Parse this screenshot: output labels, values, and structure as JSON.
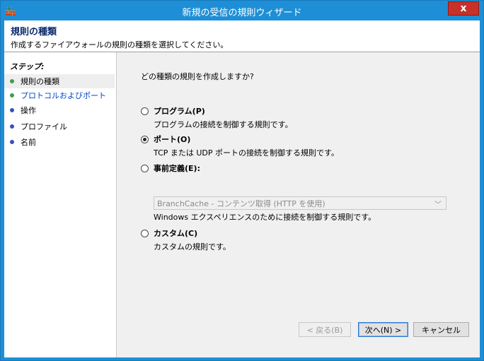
{
  "window": {
    "title": "新規の受信の規則ウィザード",
    "close_glyph": "x"
  },
  "header": {
    "title": "規則の種類",
    "description": "作成するファイアウォールの規則の種類を選択してください。"
  },
  "steps": {
    "title": "ステップ:",
    "items": [
      {
        "label": "規則の種類",
        "dot_color": "#3aa04a"
      },
      {
        "label": "プロトコルおよびポート",
        "dot_color": "#3aa04a"
      },
      {
        "label": "操作",
        "dot_color": "#3b4fb8"
      },
      {
        "label": "プロファイル",
        "dot_color": "#3b4fb8"
      },
      {
        "label": "名前",
        "dot_color": "#3b4fb8"
      }
    ]
  },
  "main": {
    "question": "どの種類の規則を作成しますか?",
    "options": [
      {
        "label": "プログラム(P)",
        "description": "プログラムの接続を制御する規則です。",
        "checked": false
      },
      {
        "label": "ポート(O)",
        "description": "TCP または UDP ポートの接続を制御する規則です。",
        "checked": true
      },
      {
        "label": "事前定義(E):",
        "description": "",
        "checked": false
      },
      {
        "label": "カスタム(C)",
        "description": "カスタムの規則です。",
        "checked": false
      }
    ],
    "predefined_select": {
      "value": "BranchCache - コンテンツ取得 (HTTP を使用)",
      "chevron": "﹀"
    },
    "predefined_description": "Windows エクスペリエンスのために接続を制御する規則です。"
  },
  "buttons": {
    "back": "< 戻る(B)",
    "next": "次へ(N) >",
    "cancel": "キャンセル"
  }
}
